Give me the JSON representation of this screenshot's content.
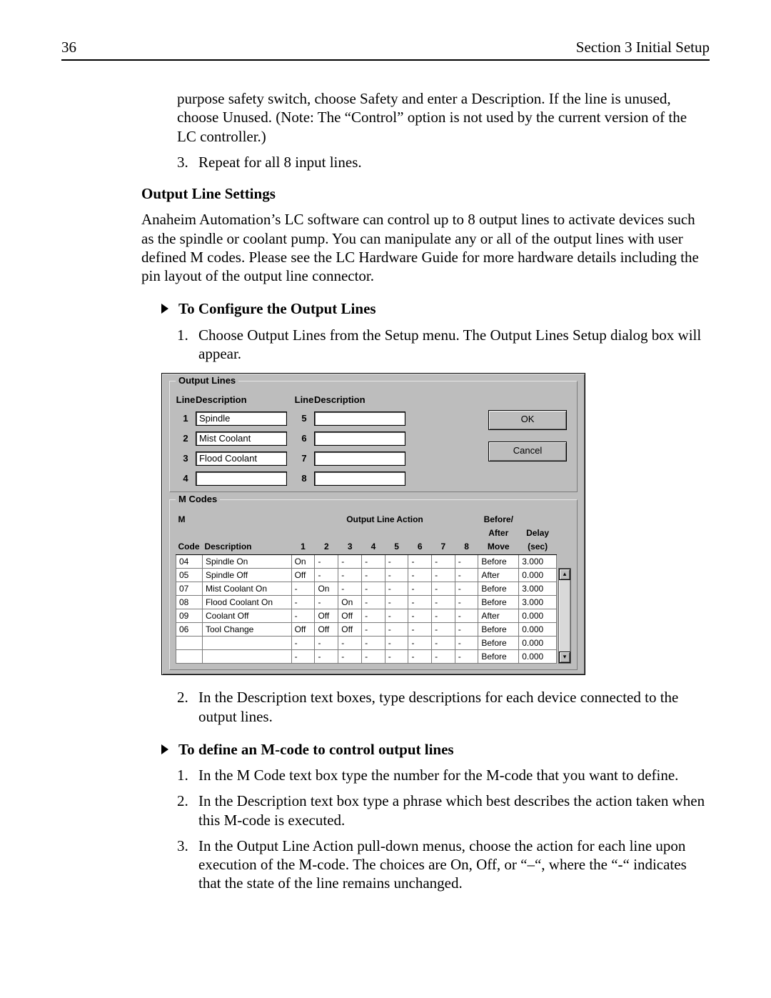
{
  "header": {
    "page_number": "36",
    "section": "Section 3 Initial Setup"
  },
  "intro_continuation": "purpose safety switch, choose Safety and enter a Description.  If the line is unused, choose Unused.  (Note: The “Control” option is not used by the current version of the LC controller.)",
  "step3": {
    "num": "3.",
    "text": "Repeat for all 8 input lines."
  },
  "output_heading": "Output Line Settings",
  "output_para": "Anaheim Automation’s LC software can control up to 8 output lines to activate devices such as the spindle or coolant pump.  You can manipulate any or all of the output lines with user defined M codes.  Please see the LC Hardware Guide for more hardware details including the pin layout of the output line connector.",
  "configure_heading": "To Configure the Output Lines",
  "configure_steps": {
    "s1": {
      "num": "1.",
      "text": "Choose Output Lines from the Setup menu.  The Output Lines Setup dialog box will appear."
    },
    "s2": {
      "num": "2.",
      "text": "In the Description text boxes, type descriptions for each device connected to the output lines."
    }
  },
  "define_heading": "To define an M-code to control output lines",
  "define_steps": {
    "s1": {
      "num": "1.",
      "text": "In the M Code text box type the number for the M-code that you want to define."
    },
    "s2": {
      "num": "2.",
      "text": "In the Description text box type a phrase which best describes the action taken when this M-code is executed."
    },
    "s3": {
      "num": "3.",
      "text": "In the Output Line Action pull-down menus, choose the action for each line upon execution of the M-code.  The choices are On, Off, or “–“, where the “-“ indicates that the state of the line remains unchanged."
    }
  },
  "dialog": {
    "group_output": "Output Lines",
    "group_mcodes": "M Codes",
    "hdr_line": "Line",
    "hdr_desc": "Description",
    "lines_left": [
      {
        "n": "1",
        "d": "Spindle"
      },
      {
        "n": "2",
        "d": "Mist Coolant"
      },
      {
        "n": "3",
        "d": "Flood Coolant"
      },
      {
        "n": "4",
        "d": ""
      }
    ],
    "lines_right": [
      {
        "n": "5",
        "d": ""
      },
      {
        "n": "6",
        "d": ""
      },
      {
        "n": "7",
        "d": ""
      },
      {
        "n": "8",
        "d": ""
      }
    ],
    "btn_ok": "OK",
    "btn_cancel": "Cancel",
    "mtable": {
      "hdr_mcode_top": "M",
      "hdr_mcode_bot": "Code",
      "hdr_desc": "Description",
      "hdr_action_span": "Output Line Action",
      "cols": [
        "1",
        "2",
        "3",
        "4",
        "5",
        "6",
        "7",
        "8"
      ],
      "hdr_before_top": "Before/",
      "hdr_before_mid": "After",
      "hdr_before_bot": "Move",
      "hdr_delay_top": "Delay",
      "hdr_delay_bot": "(sec)",
      "rows": [
        {
          "m": "04",
          "d": "Spindle On",
          "a": [
            "On",
            "-",
            "-",
            "-",
            "-",
            "-",
            "-",
            "-"
          ],
          "mv": "Before",
          "dl": "3.000"
        },
        {
          "m": "05",
          "d": "Spindle Off",
          "a": [
            "Off",
            "-",
            "-",
            "-",
            "-",
            "-",
            "-",
            "-"
          ],
          "mv": "After",
          "dl": "0.000"
        },
        {
          "m": "07",
          "d": "Mist Coolant On",
          "a": [
            "-",
            "On",
            "-",
            "-",
            "-",
            "-",
            "-",
            "-"
          ],
          "mv": "Before",
          "dl": "3.000"
        },
        {
          "m": "08",
          "d": "Flood Coolant On",
          "a": [
            "-",
            "-",
            "On",
            "-",
            "-",
            "-",
            "-",
            "-"
          ],
          "mv": "Before",
          "dl": "3.000"
        },
        {
          "m": "09",
          "d": "Coolant Off",
          "a": [
            "-",
            "Off",
            "Off",
            "-",
            "-",
            "-",
            "-",
            "-"
          ],
          "mv": "After",
          "dl": "0.000"
        },
        {
          "m": "06",
          "d": "Tool Change",
          "a": [
            "Off",
            "Off",
            "Off",
            "-",
            "-",
            "-",
            "-",
            "-"
          ],
          "mv": "Before",
          "dl": "0.000"
        },
        {
          "m": "",
          "d": "",
          "a": [
            "-",
            "-",
            "-",
            "-",
            "-",
            "-",
            "-",
            "-"
          ],
          "mv": "Before",
          "dl": "0.000"
        },
        {
          "m": "",
          "d": "",
          "a": [
            "-",
            "-",
            "-",
            "-",
            "-",
            "-",
            "-",
            "-"
          ],
          "mv": "Before",
          "dl": "0.000"
        }
      ]
    },
    "scroll_up": "▴",
    "scroll_down": "▾"
  }
}
